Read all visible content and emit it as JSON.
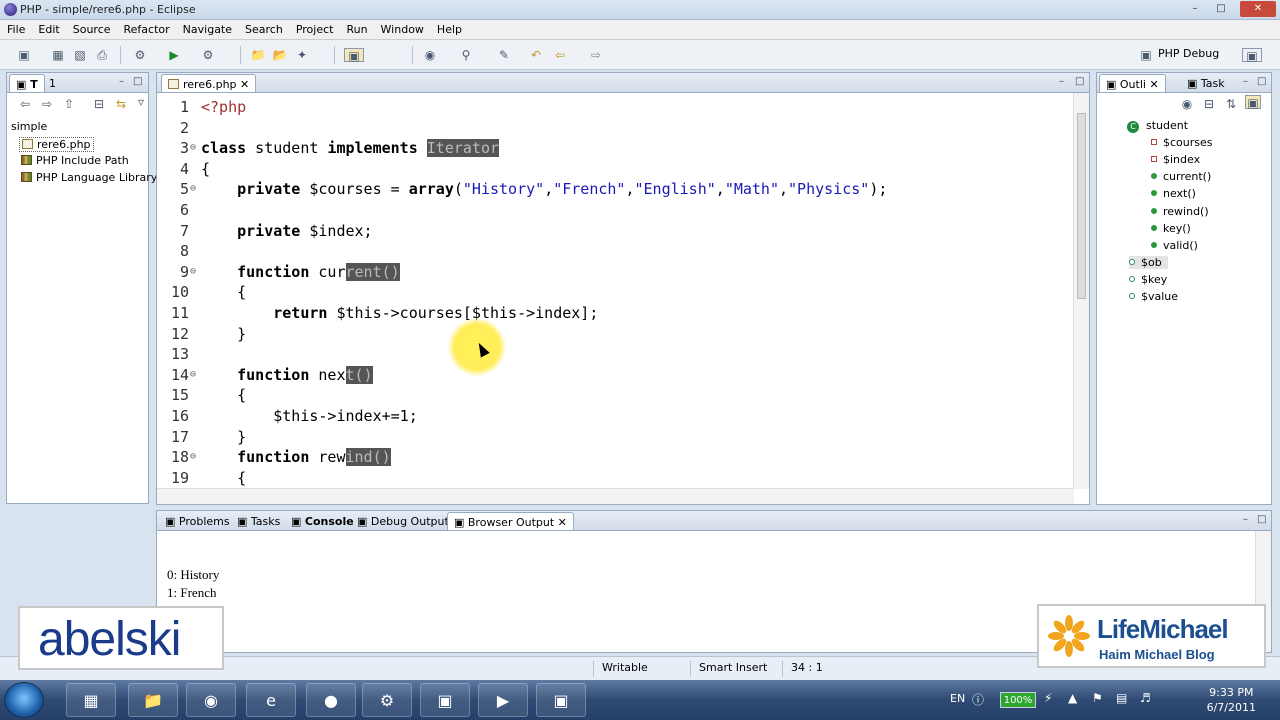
{
  "window": {
    "title": "PHP - simple/rere6.php - Eclipse"
  },
  "menu": [
    "File",
    "Edit",
    "Source",
    "Refactor",
    "Navigate",
    "Search",
    "Project",
    "Run",
    "Window",
    "Help"
  ],
  "perspective": {
    "label": "PHP Debug"
  },
  "explorer": {
    "tabs": [
      "T",
      "1"
    ],
    "items": [
      {
        "label": "simple"
      },
      {
        "label": "rere6.php"
      },
      {
        "label": "PHP Include Path"
      },
      {
        "label": "PHP Language Library"
      }
    ]
  },
  "editor": {
    "tab": "rere6.php",
    "lines": [
      {
        "n": "1",
        "fold": "",
        "html": "<span class='phptag'>&lt;?php</span>"
      },
      {
        "n": "2",
        "fold": "",
        "html": ""
      },
      {
        "n": "3",
        "fold": "⊖",
        "html": "<span class='kw'>class</span> student <span class='kw'>implements</span> <span class='hl'>Iterator</span>"
      },
      {
        "n": "4",
        "fold": "",
        "html": "{"
      },
      {
        "n": "5",
        "fold": "⊖",
        "html": "    <span class='kw'>private</span> $courses = <span class='kw'>array</span>(<span class='str'>\"History\"</span>,<span class='str'>\"French\"</span>,<span class='str'>\"English\"</span>,<span class='str'>\"Math\"</span>,<span class='str'>\"Physics\"</span>);"
      },
      {
        "n": "6",
        "fold": "",
        "html": ""
      },
      {
        "n": "7",
        "fold": "",
        "html": "    <span class='kw'>private</span> $index;"
      },
      {
        "n": "8",
        "fold": "",
        "html": ""
      },
      {
        "n": "9",
        "fold": "⊖",
        "html": "    <span class='kw'>function</span> cur<span class='hl'>rent()</span>"
      },
      {
        "n": "10",
        "fold": "",
        "html": "    {"
      },
      {
        "n": "11",
        "fold": "",
        "html": "        <span class='kw'>return</span> $this-&gt;courses[$this-&gt;index];"
      },
      {
        "n": "12",
        "fold": "",
        "html": "    }"
      },
      {
        "n": "13",
        "fold": "",
        "html": ""
      },
      {
        "n": "14",
        "fold": "⊖",
        "html": "    <span class='kw'>function</span> nex<span class='hl'>t()</span>"
      },
      {
        "n": "15",
        "fold": "",
        "html": "    {"
      },
      {
        "n": "16",
        "fold": "",
        "html": "        $this-&gt;index+=1;"
      },
      {
        "n": "17",
        "fold": "",
        "html": "    }"
      },
      {
        "n": "18",
        "fold": "⊖",
        "html": "    <span class='kw'>function</span> rew<span class='hl'>ind()</span>"
      },
      {
        "n": "19",
        "fold": "",
        "html": "    {"
      }
    ]
  },
  "outline": {
    "tabs": [
      "Outli",
      "Task"
    ],
    "items": [
      {
        "label": "student",
        "kind": "class"
      },
      {
        "label": "$courses",
        "kind": "private"
      },
      {
        "label": "$index",
        "kind": "private"
      },
      {
        "label": "current()",
        "kind": "method"
      },
      {
        "label": "next()",
        "kind": "method"
      },
      {
        "label": "rewind()",
        "kind": "method"
      },
      {
        "label": "key()",
        "kind": "method"
      },
      {
        "label": "valid()",
        "kind": "method"
      },
      {
        "label": "$ob",
        "kind": "var"
      },
      {
        "label": "$key",
        "kind": "var"
      },
      {
        "label": "$value",
        "kind": "var"
      }
    ]
  },
  "console": {
    "tabs": [
      "Problems",
      "Tasks",
      "Console",
      "Debug Output",
      "Browser Output"
    ],
    "output": [
      "0: History",
      "1: French"
    ]
  },
  "status": {
    "writable": "Writable",
    "mode": "Smart Insert",
    "position": "34 : 1"
  },
  "taskbar": {
    "lang": "EN",
    "battery": "100%",
    "time": "9:33 PM",
    "date": "6/7/2011"
  },
  "overlays": {
    "abelski": "abelski",
    "lifemichael_title": "LifeMichael",
    "lifemichael_sub": "Haim Michael Blog"
  }
}
